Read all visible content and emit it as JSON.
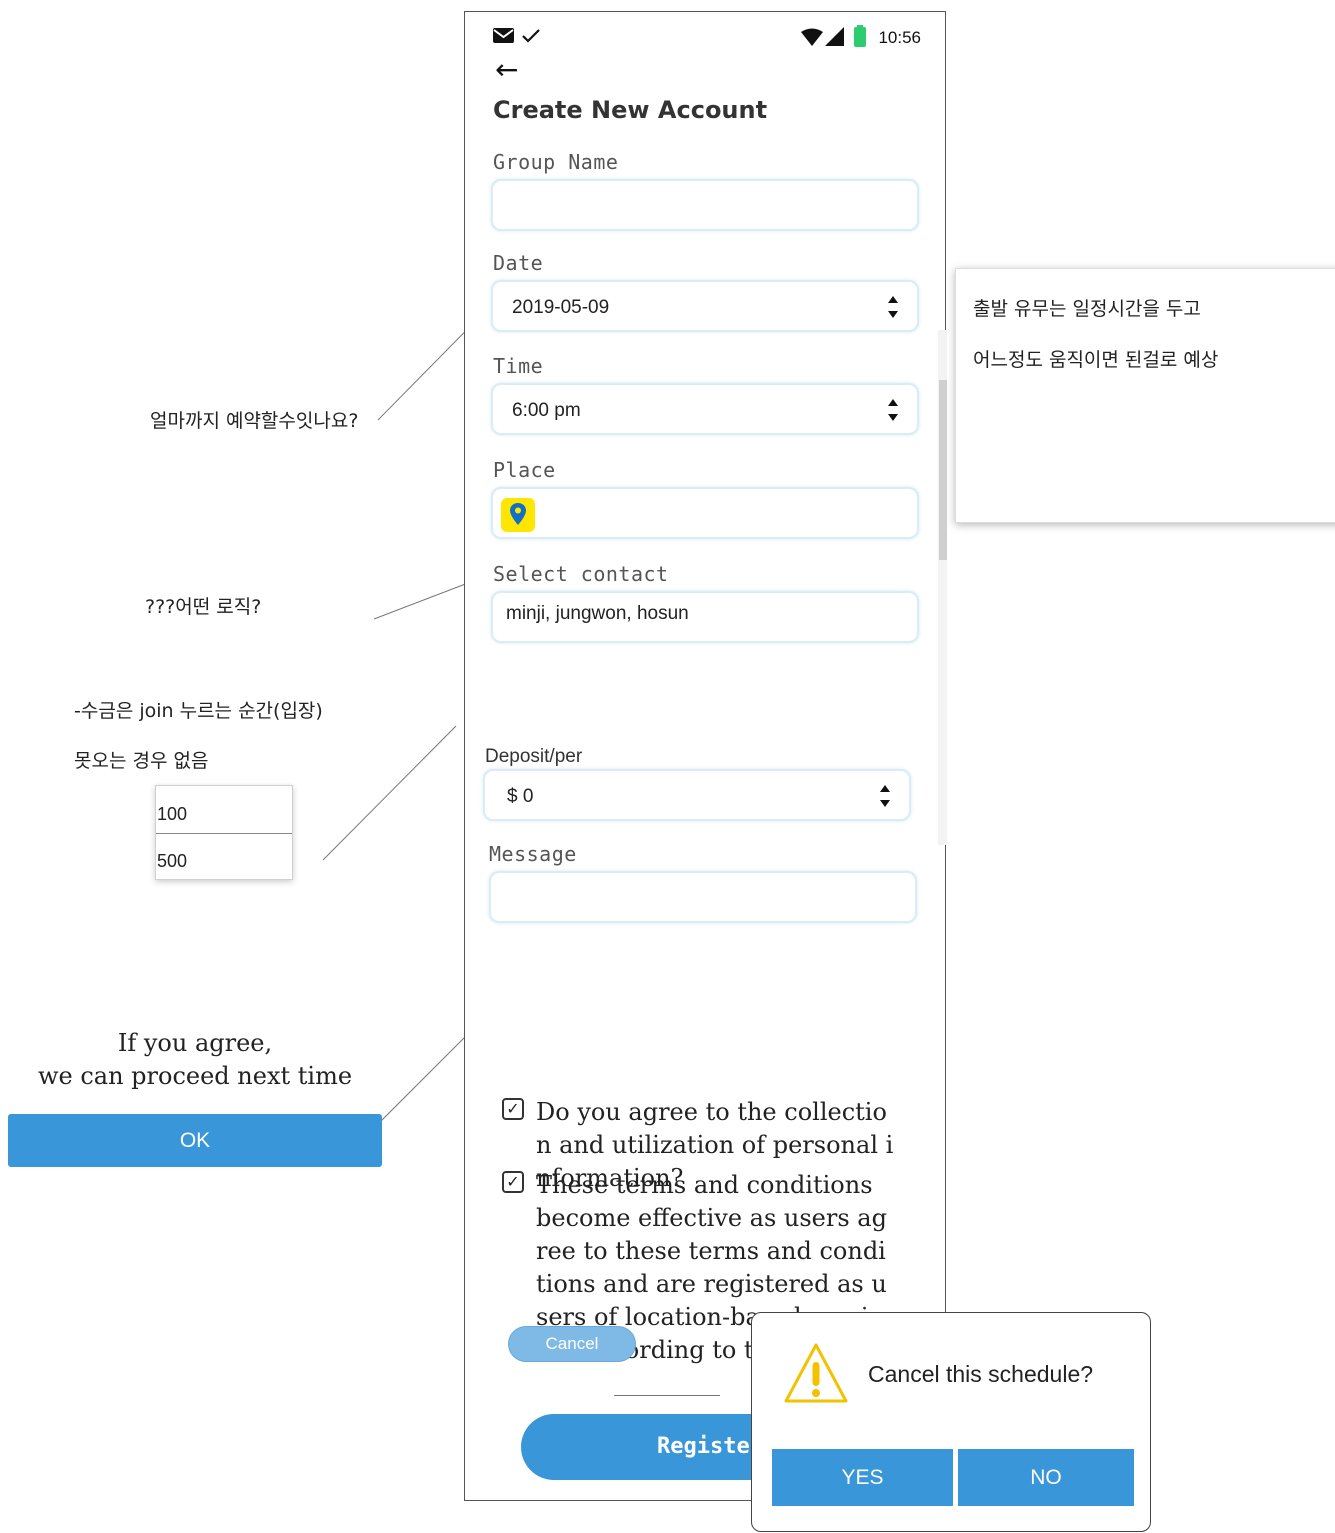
{
  "status_bar": {
    "time": "10:56"
  },
  "form": {
    "title": "Create New Account",
    "group_name": {
      "label": "Group Name",
      "value": ""
    },
    "date": {
      "label": "Date",
      "value": "2019-05-09"
    },
    "time": {
      "label": "Time",
      "value": "6:00 pm"
    },
    "place": {
      "label": "Place",
      "value": ""
    },
    "contact": {
      "label": "Select contact",
      "value": "minji, jungwon, hosun"
    },
    "deposit": {
      "label": "Deposit/per",
      "value": "$ 0"
    },
    "message": {
      "label": "Message",
      "value": ""
    },
    "terms_checkbox_1": "Do you agree to the collectio\nn and utilization of personal i\nnformation?",
    "terms_checkbox_2": "These terms and conditions\nbecome effective as users ag\nree to these terms and condi\ntions and are registered as u\nsers of location-based servi\nces according to the",
    "register_label": "Registe",
    "cancel_label": "Cancel"
  },
  "dialog": {
    "message": "Cancel this schedule?",
    "yes_label": "YES",
    "no_label": "NO"
  },
  "annotations": {
    "reservation_question": "얼마까지 예약할수잇나요?",
    "logic_question": "???어떤 로직?",
    "deposit_note_1": "-수금은 join 누르는 순간(입장)",
    "deposit_note_2": "못오는 경우 없음",
    "deposit_options": [
      "100",
      "500"
    ],
    "departure_note_1": "출발 유무는 일정시간을 두고",
    "departure_note_2": "어느정도 움직이면 된걸로 예상",
    "agree_line_1": "If you agree,",
    "agree_line_2": "we can proceed next time",
    "ok_label": "OK"
  },
  "colors": {
    "accent": "#3996d8",
    "field_border": "#d9ecf7",
    "place_icon_bg": "#ffe600",
    "warning": "#f2c200",
    "battery": "#2ecc71"
  }
}
